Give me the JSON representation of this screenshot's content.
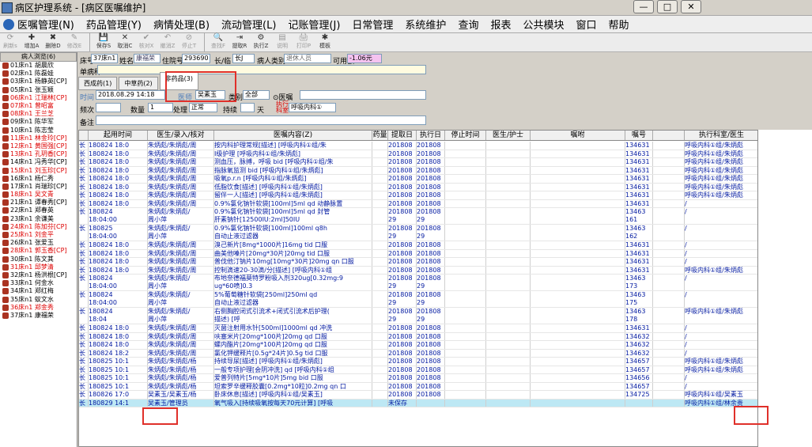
{
  "window": {
    "title": "病区护理系统 - [病区医嘱维护]",
    "min": "—",
    "restore": "□",
    "close": "✕"
  },
  "menu": [
    "医嘱管理(N)",
    "药品管理(Y)",
    "病情处理(B)",
    "流动管理(L)",
    "记账管理(J)",
    "日常管理",
    "系统维护",
    "查询",
    "报表",
    "公共模块",
    "窗口",
    "帮助"
  ],
  "toolbar": [
    {
      "icon": "⟳",
      "label": "刷新s",
      "dis": true
    },
    {
      "icon": "✚",
      "label": "增加A",
      "dis": false
    },
    {
      "icon": "✖",
      "label": "删除D",
      "dis": false
    },
    {
      "icon": "✎",
      "label": "修改E",
      "dis": true
    },
    {
      "icon": "💾",
      "label": "保存S",
      "dis": false
    },
    {
      "icon": "✕",
      "label": "取消C",
      "dis": false
    },
    {
      "icon": "✔",
      "label": "核对X",
      "dis": true
    },
    {
      "icon": "↶",
      "label": "撤消Z",
      "dis": true
    },
    {
      "icon": "⊘",
      "label": "停止T",
      "dis": true
    },
    {
      "icon": "🔍",
      "label": "查找F",
      "dis": true
    },
    {
      "icon": "⇥",
      "label": "提取R",
      "dis": false
    },
    {
      "icon": "⚙",
      "label": "执行Z",
      "dis": false
    },
    {
      "icon": "▤",
      "label": "说明",
      "dis": true
    },
    {
      "icon": "🖨",
      "label": "打印P",
      "dis": true
    },
    {
      "icon": "✱",
      "label": "模板",
      "dis": false
    }
  ],
  "patients": {
    "header": "病人浏览(6)",
    "items": [
      {
        "t": "01床n1 胡晨欣",
        "red": false
      },
      {
        "t": "02床n1 陈磊娃",
        "red": false
      },
      {
        "t": "03床n1 杨静英[CP]",
        "red": false
      },
      {
        "t": "05床n1 张玉颖",
        "red": false
      },
      {
        "t": "06床n1 江瑞林[CP]",
        "red": true
      },
      {
        "t": "07床n1 曾昭富",
        "red": true
      },
      {
        "t": "08床n1 王兰芝",
        "red": true
      },
      {
        "t": "09床n1 陈华军",
        "red": false
      },
      {
        "t": "10床n1 陈志莹",
        "red": false
      },
      {
        "t": "11床n1 林金玲[CP]",
        "red": true
      },
      {
        "t": "12床n1 黄国强[CP]",
        "red": true
      },
      {
        "t": "13床n1 孔玥香[CP]",
        "red": true
      },
      {
        "t": "14床n1 冯秀华[CP]",
        "red": false
      },
      {
        "t": "15床n1 刘玉珍[CP]",
        "red": true
      },
      {
        "t": "16床n1 杨仁秀",
        "red": false
      },
      {
        "t": "17床n1 肖瑞珍[CP]",
        "red": false
      },
      {
        "t": "18床n1 吴文青",
        "red": true
      },
      {
        "t": "21床n1 谭春秀[CP]",
        "red": false
      },
      {
        "t": "22床n1 郑春英",
        "red": false
      },
      {
        "t": "23床n1 余谦美",
        "red": false
      },
      {
        "t": "24床n1 陈加芬[CP]",
        "red": true
      },
      {
        "t": "25床n1 刘金平",
        "red": true
      },
      {
        "t": "26床n1 张爱玉",
        "red": false
      },
      {
        "t": "28床n1 郭玉香[CP]",
        "red": true
      },
      {
        "t": "30床n1 陈文其",
        "red": false
      },
      {
        "t": "31床n1 邱梦清",
        "red": true
      },
      {
        "t": "32床n1 杨洪根[CP]",
        "red": false
      },
      {
        "t": "33床n1 何金水",
        "red": false
      },
      {
        "t": "34床n1 郑红梅",
        "red": false
      },
      {
        "t": "35床n1 蚁文水",
        "red": false
      },
      {
        "t": "36床n1 郑金秀",
        "red": true
      },
      {
        "t": "37床n1 康福荣",
        "red": false
      }
    ]
  },
  "form": {
    "bed_label": "床号",
    "bed": "37床n1",
    "name_label": "姓名",
    "name": "康福荣",
    "inpatient_label": "住院号",
    "inpatient": "293690",
    "longtemp_label": "长/临",
    "longtemp": "长J",
    "type_label": "病人类别",
    "type": "退休人员",
    "balance_label": "可用额",
    "balance": "-1.06元",
    "disease_label": "单病种",
    "tabs": [
      "西成药(1)",
      "中草药(2)",
      "非药品(3)"
    ],
    "time_label": "时间",
    "time": "2018.08.29 14:18",
    "doctor_label": "医师",
    "doctor": "吴素玉",
    "category_label": "类别",
    "category": "全部",
    "order_label": "⊙医嘱",
    "freq_label": "频次",
    "qty_label": "数量",
    "qty": "1",
    "handle_label": "处理",
    "handle": "正常",
    "continue_label": "持续",
    "days_label": "天",
    "dept_label": "执行科室",
    "dept": "呼吸内科①",
    "remark_label": "备注"
  },
  "grid": {
    "headers": [
      "",
      "起用时间",
      "医生/录入/核对",
      "医嘱内容(Z)",
      "药量",
      "提取日",
      "执行日",
      "停止时间",
      "医生/护士",
      "嘱咐",
      "嘱号",
      "",
      "执行科室/医生"
    ],
    "rows": [
      {
        "c": [
          "长",
          "180824 18:0",
          "朱炳彪/朱炳彪/周",
          "按内科护理常规[描述]  [呼吸内科①组/朱",
          "",
          "201808",
          "201808",
          "",
          "",
          "",
          "134631",
          "",
          "呼吸内科①组/朱炳彪"
        ]
      },
      {
        "c": [
          "长",
          "180824 18:0",
          "朱炳彪/朱炳彪/周",
          "I级护理  [呼吸内科①组/朱炳彪]",
          "",
          "201808",
          "201808",
          "",
          "",
          "",
          "134631",
          "",
          "呼吸内科①组/朱炳彪"
        ]
      },
      {
        "c": [
          "长",
          "180824 18:0",
          "朱炳彪/朱炳彪/周",
          "测血压，脉搏，呼吸 bid  [呼吸内科①组/朱",
          "",
          "201808",
          "201808",
          "",
          "",
          "",
          "134631",
          "",
          "呼吸内科①组/朱炳彪"
        ]
      },
      {
        "c": [
          "长",
          "180824 18:0",
          "朱炳彪/朱炳彪/周",
          "指脉氧监测 bid  [呼吸内科①组/朱炳彪]",
          "",
          "201808",
          "201808",
          "",
          "",
          "",
          "134631",
          "",
          "呼吸内科①组/朱炳彪"
        ]
      },
      {
        "c": [
          "长",
          "180824 18:0",
          "朱炳彪/朱炳彪/周",
          "吸氧p.r.n  [呼吸内科①组/朱炳彪]",
          "",
          "201808",
          "201808",
          "",
          "",
          "",
          "134631",
          "",
          "呼吸内科①组/朱炳彪"
        ]
      },
      {
        "c": [
          "长",
          "180824 18:0",
          "朱炳彪/朱炳彪/周",
          "低脂饮食[描述]  [呼吸内科①组/朱炳彪]",
          "",
          "201808",
          "201808",
          "",
          "",
          "",
          "134631",
          "",
          "呼吸内科①组/朱炳彪"
        ]
      },
      {
        "c": [
          "长",
          "180824 18:0",
          "朱炳彪/朱炳彪/周",
          "留伴一人[描述]  [呼吸内科①组/朱炳彪]",
          "",
          "201808",
          "201808",
          "",
          "",
          "",
          "134631",
          "",
          "呼吸内科①组/朱炳彪"
        ]
      },
      {
        "c": [
          "长",
          "180824 18:0",
          "朱炳彪/朱炳彪/周",
          "0.9%氯化钠针软袋[100ml]5ml qd 动静脉置",
          "",
          "201808",
          "201808",
          "",
          "",
          "",
          "134631",
          "",
          "/"
        ]
      },
      {
        "tall": true,
        "c": [
          "长",
          "180824\n18:04:00",
          "朱炳彪/朱炳彪/\n周小萍",
          "0.9%氯化钠针软袋[100ml]5ml qd 封管\n肝素钠针[12500IU:2ml]50IU",
          "",
          "201808\n29",
          "201808\n29",
          "",
          "",
          "",
          "13463\n161",
          "",
          "/"
        ]
      },
      {
        "tall": true,
        "c": [
          "长",
          "180825\n18:04:00",
          "朱炳彪/朱炳彪/\n周小萍",
          "0.9%氯化钠针软袋[100ml]100ml q8h\n自动止液过滤器",
          "",
          "201808\n29",
          "201808\n29",
          "",
          "",
          "",
          "13463\n162",
          "",
          "/"
        ]
      },
      {
        "c": [
          "长",
          "180824 18:0",
          "朱炳彪/朱炳彪/周",
          "溴己新片[8mg*1000片]16mg tid 口服",
          "",
          "201808",
          "201808",
          "",
          "",
          "",
          "134631",
          "",
          "/"
        ]
      },
      {
        "c": [
          "长",
          "180824 18:0",
          "朱炳彪/朱炳彪/周",
          "曲美他嗪片[20mg*30片]20mg tid 口服",
          "",
          "201808",
          "201808",
          "",
          "",
          "",
          "134631",
          "",
          "/"
        ]
      },
      {
        "c": [
          "长",
          "180824 18:0",
          "朱炳彪/朱炳彪/周",
          "普伐他汀钠片10mg[10mg*30片]20mg qn 口服",
          "",
          "201808",
          "201808",
          "",
          "",
          "",
          "134631",
          "",
          "/"
        ]
      },
      {
        "c": [
          "长",
          "180824 18:0",
          "朱炳彪/朱炳彪/周",
          "控制滴速20-30滴/分[描述]  [呼吸内科①组",
          "",
          "201808",
          "201808",
          "",
          "",
          "",
          "134631",
          "",
          "呼吸内科①组/朱炳彪"
        ]
      },
      {
        "tall": true,
        "c": [
          "长",
          "180824\n18:04:00",
          "朱炳彪/朱炳彪/\n周小萍",
          "布地奈德福莫特罗粉吸入剂320ug[0.32mg:9\nug*60喷]0.3",
          "",
          "201808\n29",
          "201808\n29",
          "",
          "",
          "",
          "13463\n173",
          "",
          "/"
        ]
      },
      {
        "tall": true,
        "c": [
          "长",
          "180824\n18:04:00",
          "朱炳彪/朱炳彪/\n周小萍",
          "5%葡萄糖针软袋[250ml]250ml qd\n自动止液过滤器",
          "",
          "201808\n29",
          "201808\n29",
          "",
          "",
          "",
          "13463\n175",
          "",
          "/"
        ]
      },
      {
        "tall": true,
        "c": [
          "长",
          "180824\n18:04",
          "朱炳彪/朱炳彪/\n周小萍",
          "右侧胸腔闭式引流术+闭式引流术后护理(\n描述)  [呼",
          "",
          "201808\n29",
          "201808\n29",
          "",
          "",
          "",
          "13463\n178",
          "",
          "呼吸内科①组/朱炳彪"
        ]
      },
      {
        "c": [
          "长",
          "180824 18:0",
          "朱炳彪/朱炳彪/周",
          "灭菌注射用水针[500ml]1000ml qd 冲洗",
          "",
          "201808",
          "201808",
          "",
          "",
          "",
          "134631",
          "",
          "/"
        ]
      },
      {
        "c": [
          "长",
          "180824 18:0",
          "朱炳彪/朱炳彪/周",
          "呋塞米片[20mg*100片]20mg qd 口服",
          "",
          "201808",
          "201808",
          "",
          "",
          "",
          "134632",
          "",
          "/"
        ]
      },
      {
        "c": [
          "长",
          "180824 18:0",
          "朱炳彪/朱炳彪/周",
          "螺内酯片[20mg*100片]20mg qd 口服",
          "",
          "201808",
          "201808",
          "",
          "",
          "",
          "134632",
          "",
          "/"
        ]
      },
      {
        "c": [
          "长",
          "180824 18:2",
          "朱炳彪/朱炳彪/周",
          "氯化钾缓释片[0.5g*24片]0.5g tid 口服",
          "",
          "201808",
          "201808",
          "",
          "",
          "",
          "134632",
          "",
          "/"
        ]
      },
      {
        "c": [
          "长",
          "180825 10:1",
          "朱炳彪/朱炳彪/杨",
          "持续导尿[描述]  [呼吸内科①组/朱炳彪]",
          "",
          "201808",
          "201808",
          "",
          "",
          "",
          "134657",
          "",
          "呼吸内科①组/朱炳彪"
        ]
      },
      {
        "c": [
          "长",
          "180825 10:1",
          "朱炳彪/朱炳彪/杨",
          "一般专项护理[会阴冲洗] qd  [呼吸内科①组",
          "",
          "201808",
          "201808",
          "",
          "",
          "",
          "134657",
          "",
          "呼吸内科①组/朱炳彪"
        ]
      },
      {
        "c": [
          "长",
          "180825 10:1",
          "朱炳彪/朱炳彪/杨",
          "爱普列特片[5mg*10片]5mg bid 口服",
          "",
          "201808",
          "201808",
          "",
          "",
          "",
          "134656",
          "",
          "/"
        ]
      },
      {
        "c": [
          "长",
          "180825 10:1",
          "朱炳彪/朱炳彪/杨",
          "坦索罗辛缓释胶囊[0.2mg*10粒]0.2mg qn 口",
          "",
          "201808",
          "201808",
          "",
          "",
          "",
          "134657",
          "",
          "/"
        ]
      },
      {
        "c": [
          "长",
          "180826 17:0",
          "吴素玉/吴素玉/杨",
          "卧床休息[描述]  [呼吸内科①组/吴素玉]",
          "",
          "201808",
          "201808",
          "",
          "",
          "",
          "134725",
          "",
          "呼吸内科①组/吴素玉"
        ]
      },
      {
        "sel": true,
        "c": [
          "长",
          "180829 14:1",
          "吴素玉/管理员",
          "氧气吸入[持续吸氧按每天70元计算]  [呼吸",
          "",
          "未保存",
          "",
          "",
          "",
          "",
          "",
          "",
          "呼吸内科①组/林余贵"
        ]
      }
    ]
  },
  "colors": {
    "text_blue": "#0018a0",
    "red": "#e0302a",
    "selected_row": "#bde8f4"
  }
}
